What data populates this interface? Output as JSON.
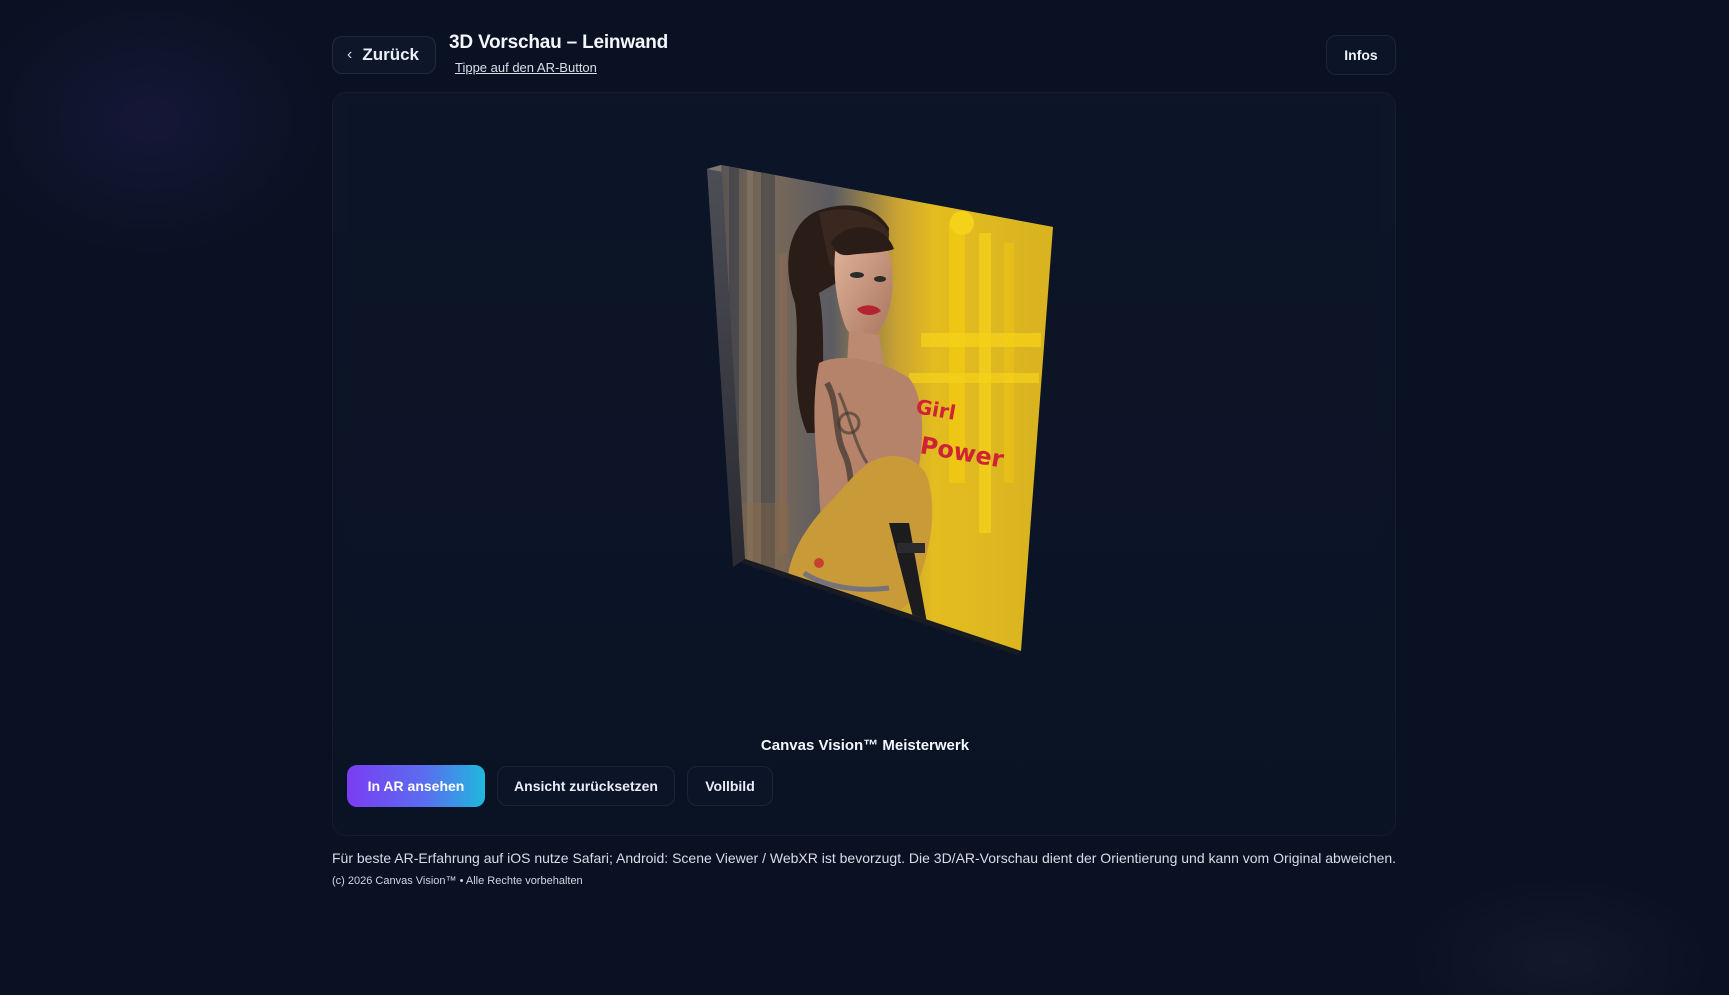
{
  "header": {
    "back_label": "Zurück",
    "title": "3D Vorschau – Leinwand",
    "subtitle": "Tippe auf den AR-Button",
    "info_label": "Infos"
  },
  "viewer": {
    "artwork_text_1": "Girl",
    "artwork_text_2": "Power",
    "caption": "Canvas Vision™ Meisterwerk"
  },
  "actions": {
    "ar_label": "In AR ansehen",
    "reset_label": "Ansicht zurücksetzen",
    "fullscreen_label": "Vollbild"
  },
  "footer": {
    "note": "Für beste AR-Erfahrung auf iOS nutze Safari; Android: Scene Viewer / WebXR ist bevorzugt. Die 3D/AR-Vorschau dient der Orientierung und kann vom Original abweichen.",
    "copyright": "(c) 2026 Canvas Vision™ • Alle Rechte vorbehalten"
  },
  "colors": {
    "background": "#0a1122",
    "ar_gradient_start": "#7b3df2",
    "ar_gradient_end": "#1fb8de",
    "painting_yellow": "#e8c31a"
  }
}
